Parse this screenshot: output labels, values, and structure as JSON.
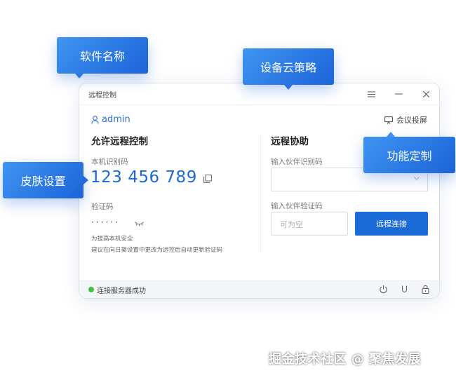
{
  "window": {
    "title": "远程控制",
    "user": "admin",
    "meeting_label": "会议投屏"
  },
  "allow": {
    "title": "允许远程控制",
    "device_id_label": "本机识别码",
    "device_id": "123 456 789",
    "password_label": "验证码",
    "password_masked": "······",
    "hint_line1": "为提高本机安全",
    "hint_line2": "建议在向日葵设置中更改为远控后自动更新验证码"
  },
  "assist": {
    "title": "远程协助",
    "partner_id_label": "输入伙伴识别码",
    "partner_pwd_label": "输入伙伴验证码",
    "partner_pwd_placeholder": "可为空",
    "connect_label": "远程连接"
  },
  "status": {
    "text": "连接服务器成功"
  },
  "callouts": {
    "software_name": "软件名称",
    "cloud_policy": "设备云策略",
    "skin": "皮肤设置",
    "feature_custom": "功能定制"
  },
  "watermark": "掘金技术社区 @ 聚焦发展",
  "colors": {
    "accent": "#1a6ad8",
    "status_ok": "#3cc53a"
  }
}
